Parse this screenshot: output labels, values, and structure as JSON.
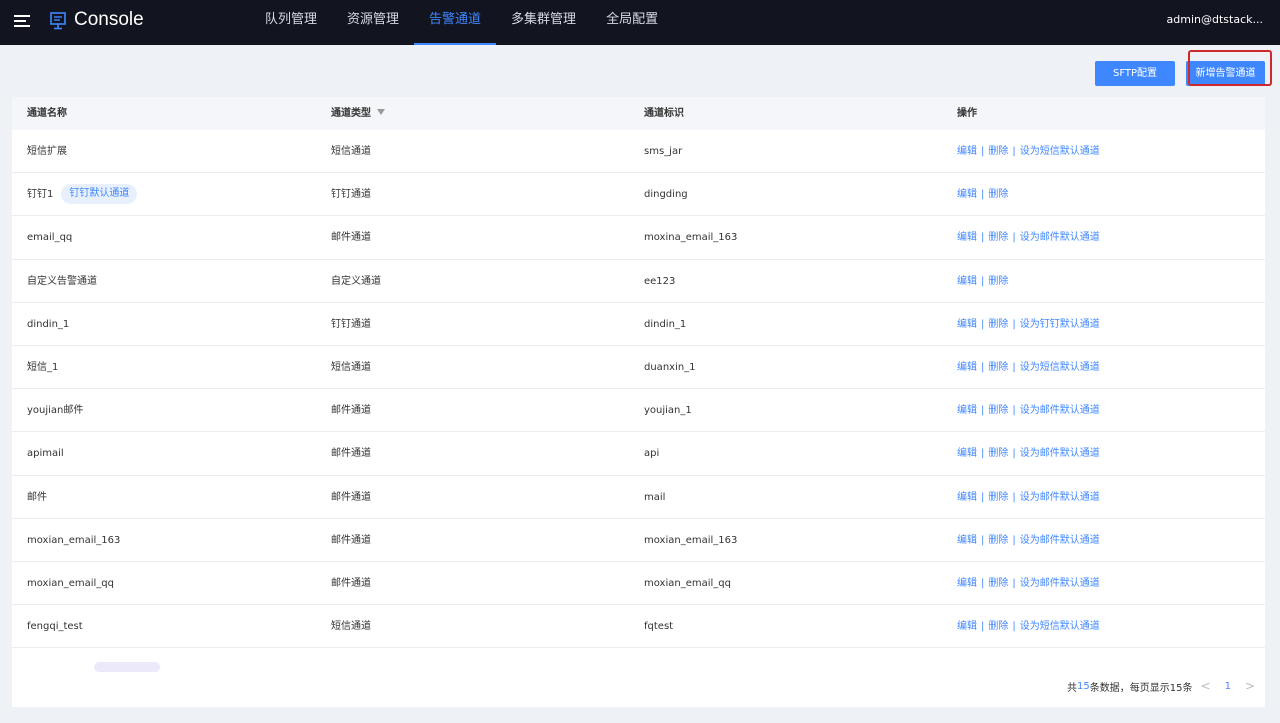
{
  "header": {
    "brand": "Console",
    "nav": [
      "队列管理",
      "资源管理",
      "告警通道",
      "多集群管理",
      "全局配置"
    ],
    "active_nav": 2,
    "user": "admin@dtstack..."
  },
  "toolbar": {
    "sftp_label": "SFTP配置",
    "new_label": "新增告警通道"
  },
  "table": {
    "columns": [
      "通道名称",
      "通道类型",
      "通道标识",
      "操作"
    ],
    "rows": [
      {
        "name": "短信扩展",
        "tag": "",
        "type": "短信通道",
        "id": "sms_jar",
        "actions": [
          "编辑",
          "删除",
          "设为短信默认通道"
        ]
      },
      {
        "name": "钉钉1",
        "tag": "钉钉默认通道",
        "type": "钉钉通道",
        "id": "dingding",
        "actions": [
          "编辑",
          "删除"
        ]
      },
      {
        "name": "email_qq",
        "tag": "",
        "type": "邮件通道",
        "id": "moxina_email_163",
        "actions": [
          "编辑",
          "删除",
          "设为邮件默认通道"
        ]
      },
      {
        "name": "自定义告警通道",
        "tag": "",
        "type": "自定义通道",
        "id": "ee123",
        "actions": [
          "编辑",
          "删除"
        ]
      },
      {
        "name": "dindin_1",
        "tag": "",
        "type": "钉钉通道",
        "id": "dindin_1",
        "actions": [
          "编辑",
          "删除",
          "设为钉钉默认通道"
        ]
      },
      {
        "name": "短信_1",
        "tag": "",
        "type": "短信通道",
        "id": "duanxin_1",
        "actions": [
          "编辑",
          "删除",
          "设为短信默认通道"
        ]
      },
      {
        "name": "youjian邮件",
        "tag": "",
        "type": "邮件通道",
        "id": "youjian_1",
        "actions": [
          "编辑",
          "删除",
          "设为邮件默认通道"
        ]
      },
      {
        "name": "apimail",
        "tag": "",
        "type": "邮件通道",
        "id": "api",
        "actions": [
          "编辑",
          "删除",
          "设为邮件默认通道"
        ]
      },
      {
        "name": "邮件",
        "tag": "",
        "type": "邮件通道",
        "id": "mail",
        "actions": [
          "编辑",
          "删除",
          "设为邮件默认通道"
        ]
      },
      {
        "name": "moxian_email_163",
        "tag": "",
        "type": "邮件通道",
        "id": "moxian_email_163",
        "actions": [
          "编辑",
          "删除",
          "设为邮件默认通道"
        ]
      },
      {
        "name": "moxian_email_qq",
        "tag": "",
        "type": "邮件通道",
        "id": "moxian_email_qq",
        "actions": [
          "编辑",
          "删除",
          "设为邮件默认通道"
        ]
      },
      {
        "name": "fengqi_test",
        "tag": "",
        "type": "短信通道",
        "id": "fqtest",
        "actions": [
          "编辑",
          "删除",
          "设为短信默认通道"
        ]
      }
    ]
  },
  "pagination": {
    "prefix": "共",
    "total": "15",
    "suffix": "条数据，每页显示15条",
    "prev": "<",
    "current": "1",
    "next": ">"
  },
  "colors": {
    "accent": "#3f87ff",
    "topbar": "#12141f",
    "highlight": "#d0292c"
  }
}
